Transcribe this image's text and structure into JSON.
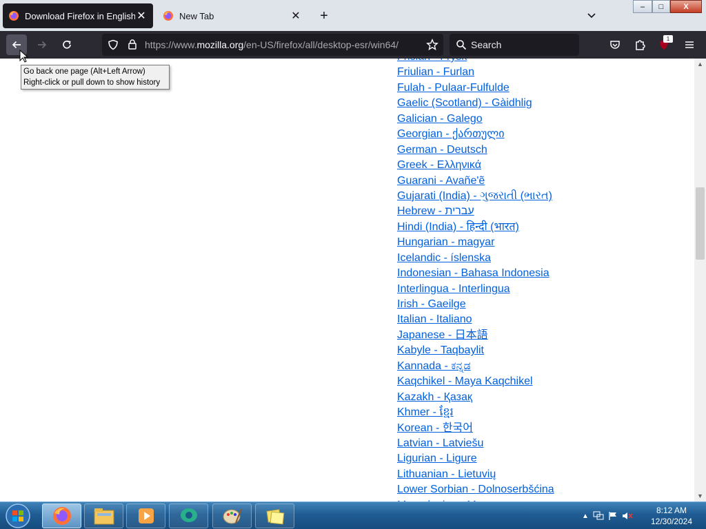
{
  "browser": {
    "tabs": [
      {
        "title": "Download Firefox in English (US)",
        "close": "✕"
      },
      {
        "title": "New Tab",
        "close": "✕"
      }
    ],
    "new_tab": "+",
    "url": {
      "prefix": "https://www.",
      "domain": "mozilla.org",
      "path": "/en-US/firefox/all/desktop-esr/win64/"
    },
    "search_placeholder": "Search",
    "extension_badge": "1",
    "tooltip": {
      "line1": "Go back one page (Alt+Left Arrow)",
      "line2": "Right-click or pull down to show history"
    },
    "window_controls": {
      "minimize": "–",
      "maximize": "□",
      "close": "X"
    }
  },
  "languages": [
    "Frisian - Frysk",
    "Friulian - Furlan",
    "Fulah - Pulaar-Fulfulde",
    "Gaelic (Scotland) - Gàidhlig",
    "Galician - Galego",
    "Georgian - ქართული",
    "German - Deutsch",
    "Greek - Ελληνικά",
    "Guarani - Avañe'ẽ",
    "Gujarati (India) - ગુજરાતી (ભારત)",
    "Hebrew - עברית",
    "Hindi (India) - हिन्दी (भारत)",
    "Hungarian - magyar",
    "Icelandic - íslenska",
    "Indonesian - Bahasa Indonesia",
    "Interlingua - Interlingua",
    "Irish - Gaeilge",
    "Italian - Italiano",
    "Japanese - 日本語",
    "Kabyle - Taqbaylit",
    "Kannada - ಕನ್ನಡ",
    "Kaqchikel - Maya Kaqchikel",
    "Kazakh - Қазақ",
    "Khmer - ខ្មែរ",
    "Korean - 한국어",
    "Latvian - Latviešu",
    "Ligurian - Ligure",
    "Lithuanian - Lietuvių",
    "Lower Sorbian - Dolnoserbšćina",
    "Macedonian - Македонски"
  ],
  "taskbar": {
    "clock_time": "8:12 AM",
    "clock_date": "12/30/2024"
  },
  "colors": {
    "link": "#0060df",
    "toolbar": "#2b2a33",
    "tabstrip": "#dfe3ea"
  }
}
